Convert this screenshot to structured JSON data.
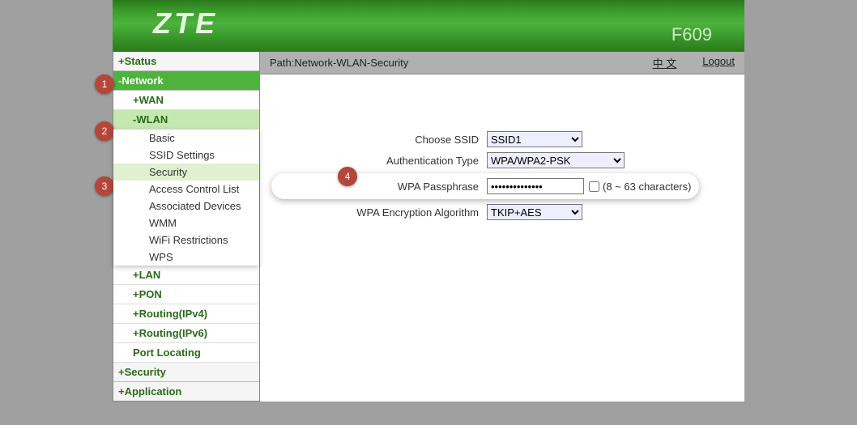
{
  "header": {
    "logo": "ZTE",
    "model": "F609"
  },
  "topbar": {
    "path_label": "Path:",
    "path_value": "Network-WLAN-Security",
    "lang_link": "中 文",
    "logout_link": "Logout"
  },
  "sidebar": {
    "status": "+Status",
    "network": "-Network",
    "wan": "+WAN",
    "wlan": "-WLAN",
    "wlan_items": {
      "basic": "Basic",
      "ssid_settings": "SSID Settings",
      "security": "Security",
      "acl": "Access Control List",
      "assoc": "Associated Devices",
      "wmm": "WMM",
      "wifi_restr": "WiFi Restrictions",
      "wps": "WPS"
    },
    "lan": "+LAN",
    "pon": "+PON",
    "routing4": "+Routing(IPv4)",
    "routing6": "+Routing(IPv6)",
    "port_loc": "Port Locating",
    "security": "+Security",
    "application": "+Application"
  },
  "form": {
    "choose_ssid_label": "Choose SSID",
    "choose_ssid_value": "SSID1",
    "auth_type_label": "Authentication Type",
    "auth_type_value": "WPA/WPA2-PSK",
    "passphrase_label": "WPA Passphrase",
    "passphrase_value": "••••••••••••••",
    "passphrase_hint": "(8 ~ 63 characters)",
    "enc_alg_label": "WPA Encryption Algorithm",
    "enc_alg_value": "TKIP+AES"
  },
  "annotations": {
    "a1": "1",
    "a2": "2",
    "a3": "3",
    "a4": "4"
  }
}
